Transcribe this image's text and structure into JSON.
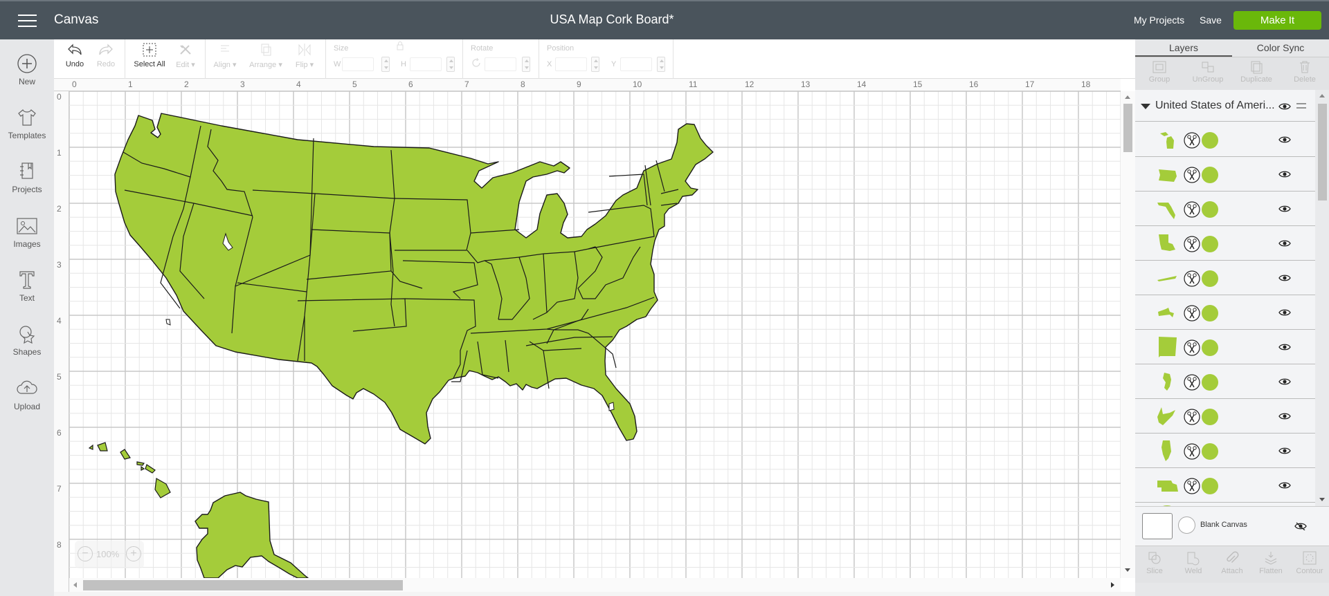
{
  "header": {
    "app_title": "Canvas",
    "doc_title": "USA Map Cork Board*",
    "my_projects": "My Projects",
    "save": "Save",
    "make_it": "Make It"
  },
  "colors": {
    "accent_green": "#6ab80a",
    "shape_fill": "#a4cc3a",
    "topbar": "#4a545c"
  },
  "sidebar": {
    "items": [
      {
        "label": "New",
        "icon": "plus-circle-icon"
      },
      {
        "label": "Templates",
        "icon": "tshirt-icon"
      },
      {
        "label": "Projects",
        "icon": "notebook-icon"
      },
      {
        "label": "Images",
        "icon": "image-icon"
      },
      {
        "label": "Text",
        "icon": "text-t-icon"
      },
      {
        "label": "Shapes",
        "icon": "shapes-icon"
      },
      {
        "label": "Upload",
        "icon": "cloud-upload-icon"
      }
    ]
  },
  "toolbar": {
    "undo": "Undo",
    "redo": "Redo",
    "select_all": "Select All",
    "edit": "Edit",
    "align": "Align",
    "arrange": "Arrange",
    "flip": "Flip",
    "size_label": "Size",
    "w_label": "W",
    "h_label": "H",
    "rotate_label": "Rotate",
    "position_label": "Position",
    "x_label": "X",
    "y_label": "Y"
  },
  "canvas": {
    "ruler_top": [
      "0",
      "1",
      "2",
      "3",
      "4",
      "5",
      "6",
      "7",
      "8",
      "9",
      "10",
      "11",
      "12",
      "13",
      "14",
      "15",
      "16",
      "17",
      "18"
    ],
    "ruler_left": [
      "0",
      "1",
      "2",
      "3",
      "4",
      "5",
      "6",
      "7",
      "8"
    ],
    "zoom_level": "100%"
  },
  "panel": {
    "tabs": [
      "Layers",
      "Color Sync"
    ],
    "tools": [
      "Group",
      "UnGroup",
      "Duplicate",
      "Delete"
    ],
    "group_name": "United States of Ameri...",
    "layers": [
      {
        "shape": "Michigan"
      },
      {
        "shape": "Oregon"
      },
      {
        "shape": "Florida"
      },
      {
        "shape": "Louisiana"
      },
      {
        "shape": "Tennessee"
      },
      {
        "shape": "Massachusetts"
      },
      {
        "shape": "New Mexico"
      },
      {
        "shape": "New Jersey"
      },
      {
        "shape": "West Virginia"
      },
      {
        "shape": "Illinois"
      },
      {
        "shape": "Nebraska"
      }
    ],
    "blank_canvas": "Blank Canvas",
    "bottom_tools": [
      "Slice",
      "Weld",
      "Attach",
      "Flatten",
      "Contour"
    ]
  }
}
